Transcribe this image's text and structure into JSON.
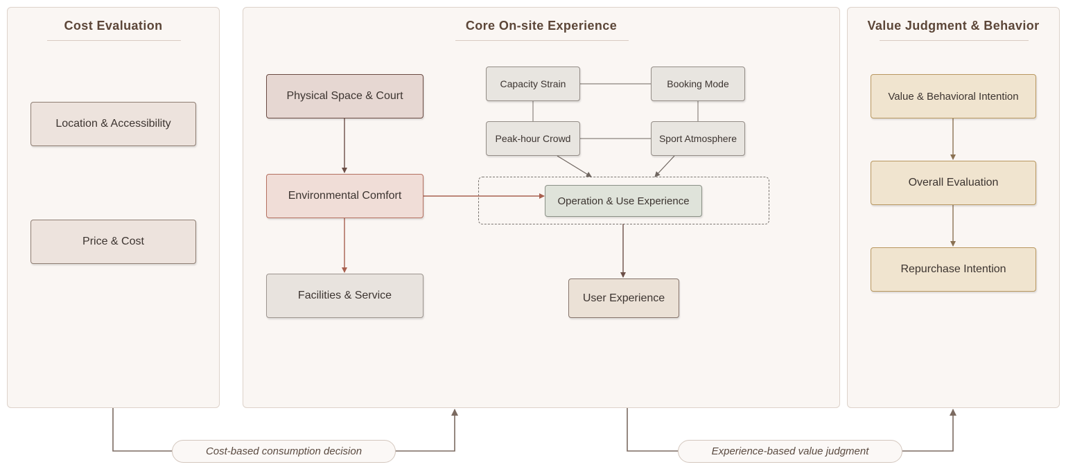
{
  "panels": {
    "cost": {
      "title": "Cost Evaluation"
    },
    "core": {
      "title": "Core On-site Experience"
    },
    "value": {
      "title": "Value Judgment & Behavior"
    }
  },
  "nodes": {
    "location": "Location & Accessibility",
    "price": "Price & Cost",
    "physical": "Physical Space & Court",
    "environmental": "Environmental Comfort",
    "facilities": "Facilities & Service",
    "capacity": "Capacity Strain",
    "booking": "Booking Mode",
    "peak": "Peak-hour Crowd",
    "atmosphere": "Sport Atmosphere",
    "operation": "Operation & Use Experience",
    "user_experience": "User Experience",
    "value_intention": "Value & Behavioral Intention",
    "overall": "Overall Evaluation",
    "repurchase": "Repurchase Intention"
  },
  "flows": {
    "cost_decision": "Cost-based consumption decision",
    "value_judgment": "Experience-based value judgment"
  },
  "colors": {
    "panel_bg": "#faf6f3",
    "title_text": "#5c4638",
    "connector": "#7b6a60",
    "environment_accent": "#b46f5f",
    "value_accent": "#b8975f"
  }
}
